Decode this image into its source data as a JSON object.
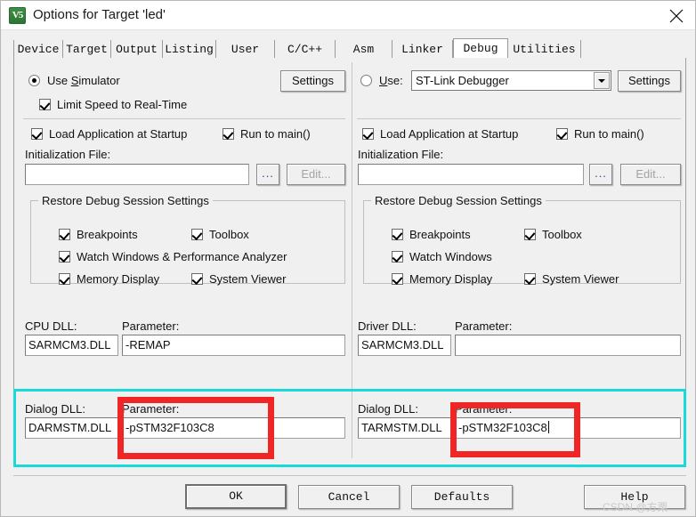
{
  "window": {
    "title": "Options for Target 'led'",
    "icon_name": "keil-uvision-icon",
    "icon_glyph": "V5",
    "close_label": "×"
  },
  "tabs": [
    {
      "label": "Device",
      "active": false
    },
    {
      "label": "Target",
      "active": false
    },
    {
      "label": "Output",
      "active": false
    },
    {
      "label": "Listing",
      "active": false
    },
    {
      "label": "User",
      "active": false
    },
    {
      "label": "C/C++",
      "active": false
    },
    {
      "label": "Asm",
      "active": false
    },
    {
      "label": "Linker",
      "active": false
    },
    {
      "label": "Debug",
      "active": true
    },
    {
      "label": "Utilities",
      "active": false
    }
  ],
  "left_panel": {
    "use_simulator": {
      "label_pre": "Use ",
      "label_accel": "S",
      "label_post": "imulator",
      "checked": true
    },
    "settings_button": "Settings",
    "limit_speed": {
      "label": "Limit Speed to Real-Time",
      "checked": true
    },
    "load_app": {
      "label": "Load Application at Startup",
      "checked": true
    },
    "run_to_main": {
      "label": "Run to main()",
      "checked": true
    },
    "init_file_label": "Initialization File:",
    "init_file_value": "",
    "browse_button": "...",
    "edit_button": "Edit...",
    "restore_group": {
      "title": "Restore Debug Session Settings",
      "items": [
        {
          "label": "Breakpoints",
          "checked": true
        },
        {
          "label": "Toolbox",
          "checked": true
        },
        {
          "label": "Watch Windows & Performance Analyzer",
          "checked": true
        },
        {
          "label": "Memory Display",
          "checked": true
        },
        {
          "label": "System Viewer",
          "checked": true
        }
      ]
    },
    "cpu_dll_label": "CPU DLL:",
    "cpu_dll_value": "SARMCM3.DLL",
    "cpu_param_label": "Parameter:",
    "cpu_param_value": "-REMAP",
    "dialog_dll_label": "Dialog DLL:",
    "dialog_dll_value": "DARMSTM.DLL",
    "dialog_param_label": "Parameter:",
    "dialog_param_value": "-pSTM32F103C8"
  },
  "right_panel": {
    "use_radio": {
      "label_pre": "",
      "label_accel": "U",
      "label_post": "se:",
      "checked": false
    },
    "debugger_value": "ST-Link Debugger",
    "settings_button": "Settings",
    "load_app": {
      "label": "Load Application at Startup",
      "checked": true
    },
    "run_to_main": {
      "label": "Run to main()",
      "checked": true
    },
    "init_file_label": "Initialization File:",
    "init_file_value": "",
    "browse_button": "...",
    "edit_button": "Edit...",
    "restore_group": {
      "title": "Restore Debug Session Settings",
      "items": [
        {
          "label": "Breakpoints",
          "checked": true
        },
        {
          "label": "Toolbox",
          "checked": true
        },
        {
          "label": "Watch Windows",
          "checked": true
        },
        {
          "label": "Memory Display",
          "checked": true
        },
        {
          "label": "System Viewer",
          "checked": true
        }
      ]
    },
    "driver_dll_label": "Driver DLL:",
    "driver_dll_value": "SARMCM3.DLL",
    "driver_param_label": "Parameter:",
    "driver_param_value": "",
    "dialog_dll_label": "Dialog DLL:",
    "dialog_dll_value": "TARMSTM.DLL",
    "dialog_param_label": "Parameter:",
    "dialog_param_value": "-pSTM32F103C8"
  },
  "footer": {
    "ok": "OK",
    "cancel": "Cancel",
    "defaults": "Defaults",
    "help": "Help"
  },
  "annotations": {
    "cyan_color": "#19d9d9",
    "red_color": "#f02626"
  },
  "watermark": "CSDN @方栗"
}
